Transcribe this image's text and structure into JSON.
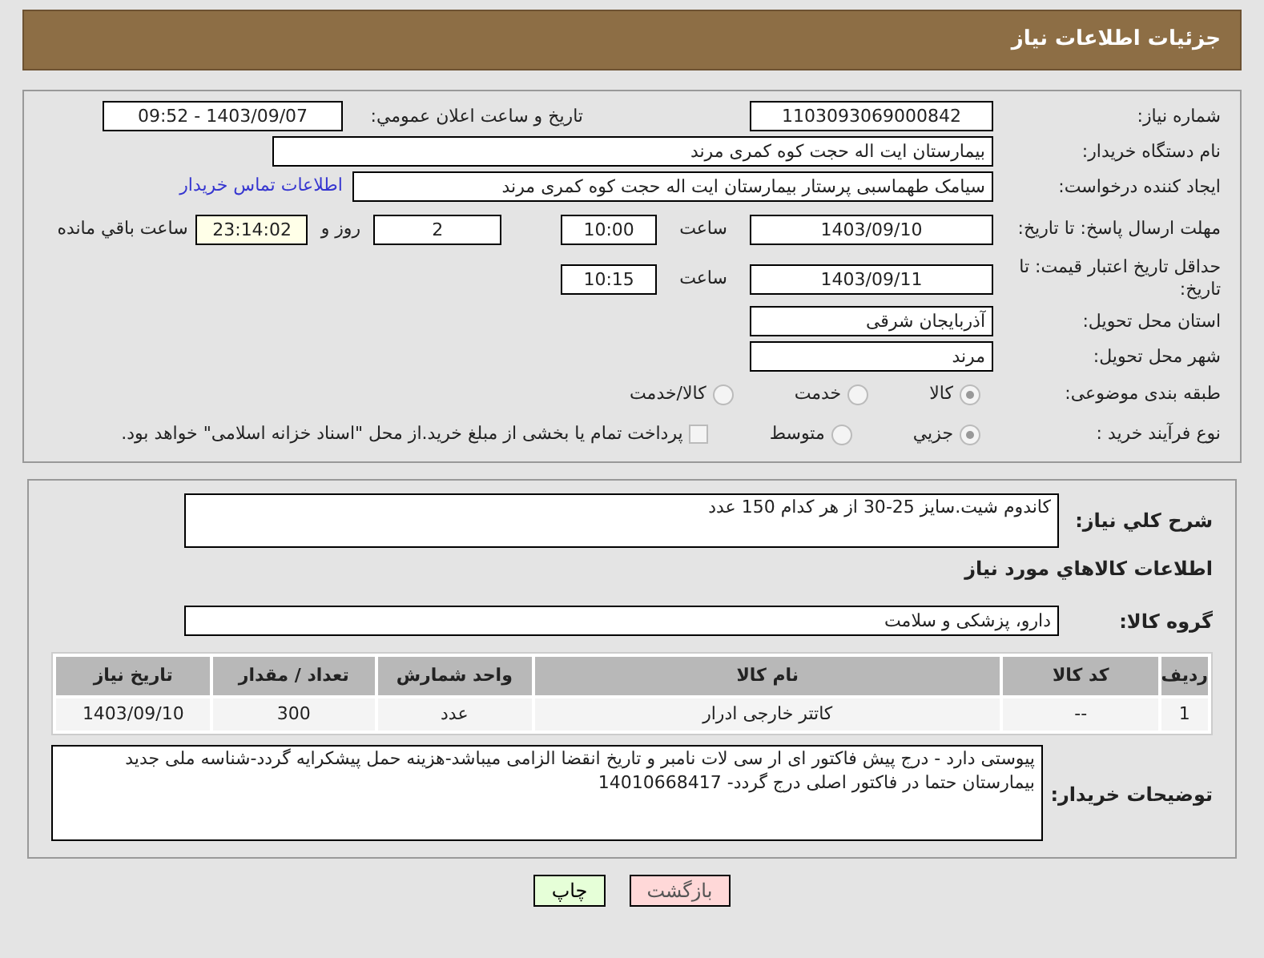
{
  "header": {
    "title": "جزئیات اطلاعات نیاز"
  },
  "need_number": {
    "label": "شماره نیاز:",
    "value": "1103093069000842"
  },
  "announce": {
    "label": "تاریخ و ساعت اعلان عمومي:",
    "value": "1403/09/07 - 09:52"
  },
  "buyer_org": {
    "label": "نام دستگاه خریدار:",
    "value": "بیمارستان ایت اله حجت کوه کمری مرند"
  },
  "requester": {
    "label": "ایجاد کننده درخواست:",
    "value": "سیامک طهماسبی پرستار بیمارستان ایت اله حجت کوه کمری مرند",
    "link": "اطلاعات تماس خریدار"
  },
  "deadline": {
    "label": "مهلت ارسال پاسخ: تا تاریخ:",
    "date": "1403/09/10",
    "time_label": "ساعت",
    "time": "10:00",
    "days": "2",
    "days_label": "روز و",
    "remaining": "23:14:02",
    "remaining_label": "ساعت باقي مانده"
  },
  "validity": {
    "label": "حداقل تاریخ اعتبار قیمت: تا تاریخ:",
    "date": "1403/09/11",
    "time_label": "ساعت",
    "time": "10:15"
  },
  "province": {
    "label": "استان محل تحویل:",
    "value": "آذربایجان شرقی"
  },
  "city": {
    "label": "شهر محل تحویل:",
    "value": "مرند"
  },
  "category": {
    "label": "طبقه بندی موضوعی:",
    "options": [
      {
        "label": "کالا",
        "selected": true
      },
      {
        "label": "خدمت",
        "selected": false
      },
      {
        "label": "کالا/خدمت",
        "selected": false
      }
    ]
  },
  "process": {
    "label": "نوع فرآیند خرید :",
    "options": [
      {
        "label": "جزیي",
        "selected": true
      },
      {
        "label": "متوسط",
        "selected": false
      }
    ],
    "checkbox": {
      "label": "پرداخت تمام یا بخشی از مبلغ خرید.از محل \"اسناد خزانه اسلامی\" خواهد بود.",
      "checked": false
    }
  },
  "description": {
    "label": "شرح کلي نیاز:",
    "value": "کاندوم شیت.سایز 25-30 از هر کدام 150 عدد"
  },
  "goods_heading": "اطلاعات کالاهاي مورد نیاز",
  "goods_group": {
    "label": "گروه کالا:",
    "value": "دارو، پزشکی و سلامت"
  },
  "table": {
    "columns": [
      "ردیف",
      "کد کالا",
      "نام کالا",
      "واحد شمارش",
      "تعداد / مقدار",
      "تاریخ نیاز"
    ],
    "rows": [
      [
        "1",
        "--",
        "کاتتر خارجی ادرار",
        "عدد",
        "300",
        "1403/09/10"
      ]
    ]
  },
  "notes": {
    "label": "توضیحات خریدار:",
    "value": "پیوستی دارد - درج پیش فاکتور ای ار سی لات نامبر و تاریخ انقضا الزامی میباشد-هزینه حمل پیشکرایه گردد-شناسه ملی جدید بیمارستان حتما در فاکتور اصلی درج  گردد- 14010668417"
  },
  "buttons": [
    {
      "label": "بازگشت",
      "kind": "back"
    },
    {
      "label": "چاپ",
      "kind": "print"
    }
  ]
}
